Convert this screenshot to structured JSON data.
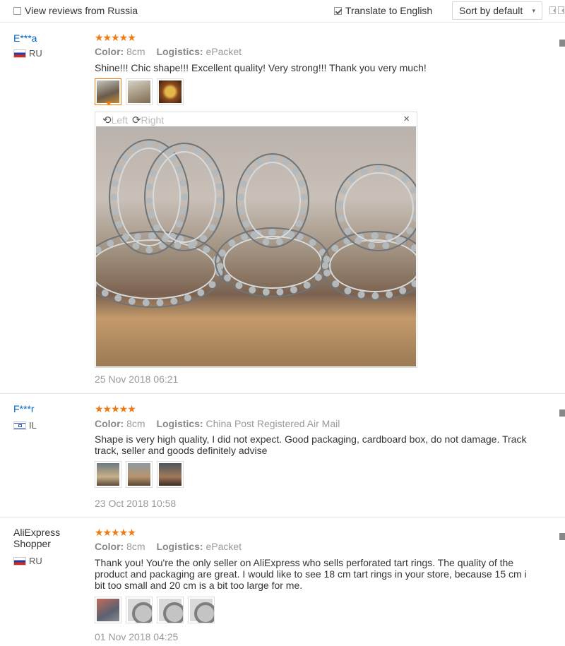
{
  "filters": {
    "russia_label": "View reviews from Russia",
    "russia_checked": false,
    "translate_label": "Translate to English",
    "translate_checked": true,
    "sort_label": "Sort by default"
  },
  "viewer": {
    "left_label": "Left",
    "right_label": "Right",
    "close_symbol": "×"
  },
  "reviews": [
    {
      "user": "E***a",
      "country_code": "RU",
      "stars": "★★★★★",
      "color_key": "Color:",
      "color_val": "8cm",
      "logistics_key": "Logistics:",
      "logistics_val": "ePacket",
      "text": "Shine!!! Chic shape!!! Excellent quality! Very strong!!! Thank you very much!",
      "date": "25 Nov 2018 06:21"
    },
    {
      "user": "F***r",
      "country_code": "IL",
      "stars": "★★★★★",
      "color_key": "Color:",
      "color_val": "8cm",
      "logistics_key": "Logistics:",
      "logistics_val": "China Post Registered Air Mail",
      "text": "Shape is very high quality, I did not expect. Good packaging, cardboard box, do not damage. Track\ntrack, seller and goods definitely advise",
      "date": "23 Oct 2018 10:58"
    },
    {
      "user": "AliExpress Shopper",
      "country_code": "RU",
      "stars": "★★★★★",
      "color_key": "Color:",
      "color_val": "8cm",
      "logistics_key": "Logistics:",
      "logistics_val": "ePacket",
      "text": "Thank you! You're the only seller on AliExpress who sells perforated tart rings. The quality of the\nproduct and packaging are great. I would like to see 18 cm tart rings in your store, because 15 cm i\nbit too small and 20 cm is a bit too large for me.",
      "date": "01 Nov 2018 04:25"
    }
  ],
  "colors": {
    "star": "#f07a12",
    "link": "#0066cc",
    "muted": "#999999"
  }
}
